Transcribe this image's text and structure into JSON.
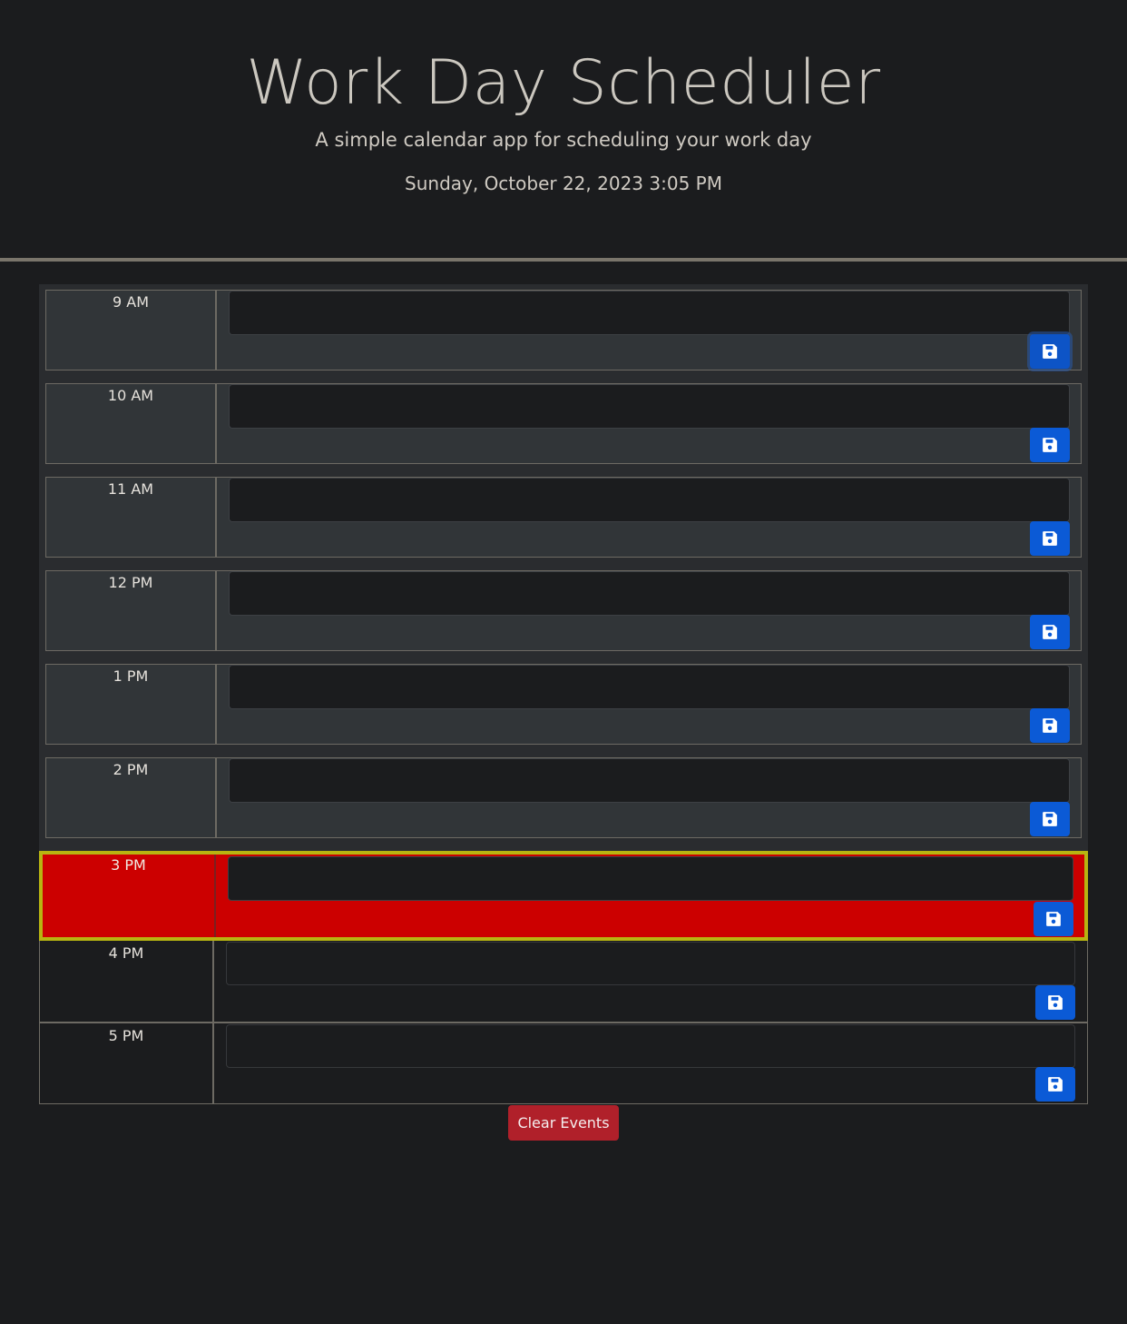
{
  "header": {
    "title": "Work Day Scheduler",
    "subtitle": "A simple calendar app for scheduling your work day",
    "datetime": "Sunday, October 22, 2023 3:05 PM"
  },
  "time_blocks": [
    {
      "hour": "9 AM",
      "state": "past",
      "text": ""
    },
    {
      "hour": "10 AM",
      "state": "past",
      "text": ""
    },
    {
      "hour": "11 AM",
      "state": "past",
      "text": ""
    },
    {
      "hour": "12 PM",
      "state": "past",
      "text": ""
    },
    {
      "hour": "1 PM",
      "state": "past",
      "text": ""
    },
    {
      "hour": "2 PM",
      "state": "past",
      "text": ""
    },
    {
      "hour": "3 PM",
      "state": "present",
      "text": ""
    },
    {
      "hour": "4 PM",
      "state": "future",
      "text": ""
    },
    {
      "hour": "5 PM",
      "state": "future",
      "text": ""
    }
  ],
  "save_icon": "save-icon",
  "clear_button": {
    "label": "Clear Events"
  },
  "colors": {
    "background": "#1b1c1e",
    "past": "#313538",
    "present": "#cc0000",
    "present_outline": "#b8b411",
    "save_button": "#0b5ad6",
    "clear_button": "#b0202a"
  }
}
